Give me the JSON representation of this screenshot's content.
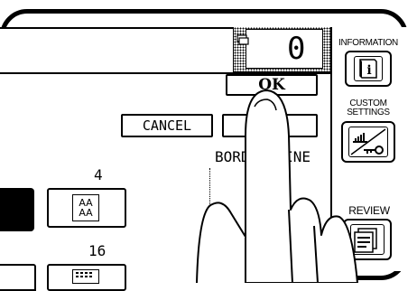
{
  "copy_counter": {
    "value": "0"
  },
  "dialog": {
    "ok_label": "OK",
    "cancel_label": "CANCEL",
    "second_ok_label": "OK",
    "border_line_label": "BORDER LINE"
  },
  "layout_options": [
    {
      "number": "4",
      "icon_text": "AA\nAA"
    },
    {
      "number": "16",
      "icon_text": ""
    }
  ],
  "side_panel": {
    "information_label": "INFORMATION",
    "custom_settings_label_line1": "CUSTOM",
    "custom_settings_label_line2": "SETTINGS",
    "review_label": "REVIEW"
  }
}
